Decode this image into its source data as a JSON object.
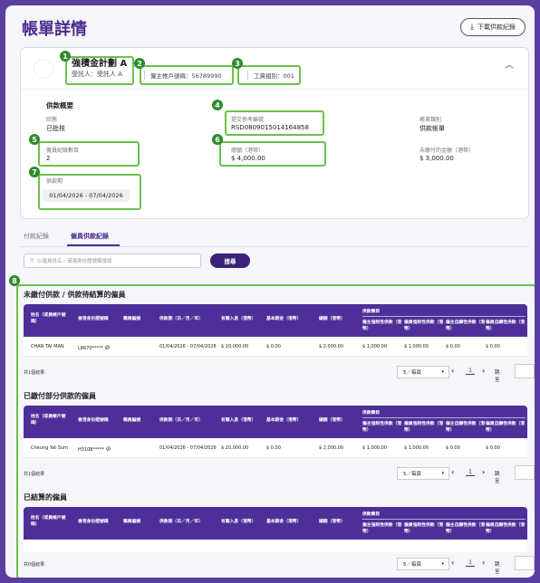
{
  "header": {
    "title": "帳單詳情",
    "download_label": "下載供款紀錄",
    "download_icon": "download-icon"
  },
  "summary_card": {
    "plan_name": "強積金計劃 A",
    "trustee": "受託人：受託人 A",
    "employer_account": "僱主帳戶號碼：56789990",
    "payroll_group": "工資組別：001",
    "section_title": "供款概要",
    "status_label": "狀態",
    "status_value": "已批核",
    "ref_label": "提交參考編號",
    "ref_value": "RSD0809015014164858",
    "bill_type_label": "帳單類別",
    "bill_type_value": "供款帳單",
    "employee_count_label": "僱員紀錄數目",
    "employee_count_value": "2",
    "total_label": "總額（港幣）",
    "total_value": "$ 4,000.00",
    "unpaid_label": "未繳付的金額（港幣）",
    "unpaid_value": "$ 3,000.00",
    "period_label": "供款期",
    "period_value": "01/04/2026 - 07/04/2026"
  },
  "markers": [
    "1",
    "2",
    "3",
    "4",
    "5",
    "6",
    "7",
    "8"
  ],
  "tabs": [
    {
      "label": "付款紀錄",
      "active": false
    },
    {
      "label": "僱員供款紀錄",
      "active": true
    }
  ],
  "search": {
    "placeholder": "以僱員姓名／港澳身份證號碼搜尋",
    "button_label": "搜尋"
  },
  "table_headers": {
    "name": "姓名（或員帳戶號碼）",
    "id_no": "香港身份證號碼",
    "staff_no": "職員編號",
    "period": "供款期（日／月／年）",
    "income": "有關入息（港幣）",
    "basic_salary": "基本薪金（港幣）",
    "total": "總額（港幣）",
    "group": "供款類目",
    "er_mc": "僱主強制性供款（港幣）",
    "ee_mc": "僱員強制性供款（港幣）",
    "er_vc": "僱主自願性供款（港幣）",
    "ee_vc": "僱員自願性供款（港幣）"
  },
  "groups": [
    {
      "title": "未繳付供款 / 供款待結算的僱員",
      "rows": [
        {
          "name": "CHAN TAI MAN",
          "id": "L8670*****",
          "staff": "",
          "period": "01/04/2026 - 07/04/2026",
          "income": "$ 20,000.00",
          "basic": "$ 0.00",
          "total": "$ 2,000.00",
          "er_mc": "$ 1,000.00",
          "ee_mc": "$ 1,000.00",
          "er_vc": "$ 0.00",
          "ee_vc": "$ 0.00"
        }
      ],
      "results": "共1個結果"
    },
    {
      "title": "已繳付部分供款的僱員",
      "rows": [
        {
          "name": "Cheung Yat Sum",
          "id": "H3108*****",
          "staff": "",
          "period": "01/04/2026 - 07/04/2026",
          "income": "$ 20,000.00",
          "basic": "$ 0.00",
          "total": "$ 2,000.00",
          "er_mc": "$ 1,000.00",
          "ee_mc": "$ 1,000.00",
          "er_vc": "$ 0.00",
          "ee_vc": "$ 0.00"
        }
      ],
      "results": "共1個結果"
    },
    {
      "title": "已結算的僱員",
      "rows": [],
      "results": "共0個結果"
    }
  ],
  "pager": {
    "per_page": "5／每頁",
    "page": "1",
    "jump_label": "跳至"
  }
}
